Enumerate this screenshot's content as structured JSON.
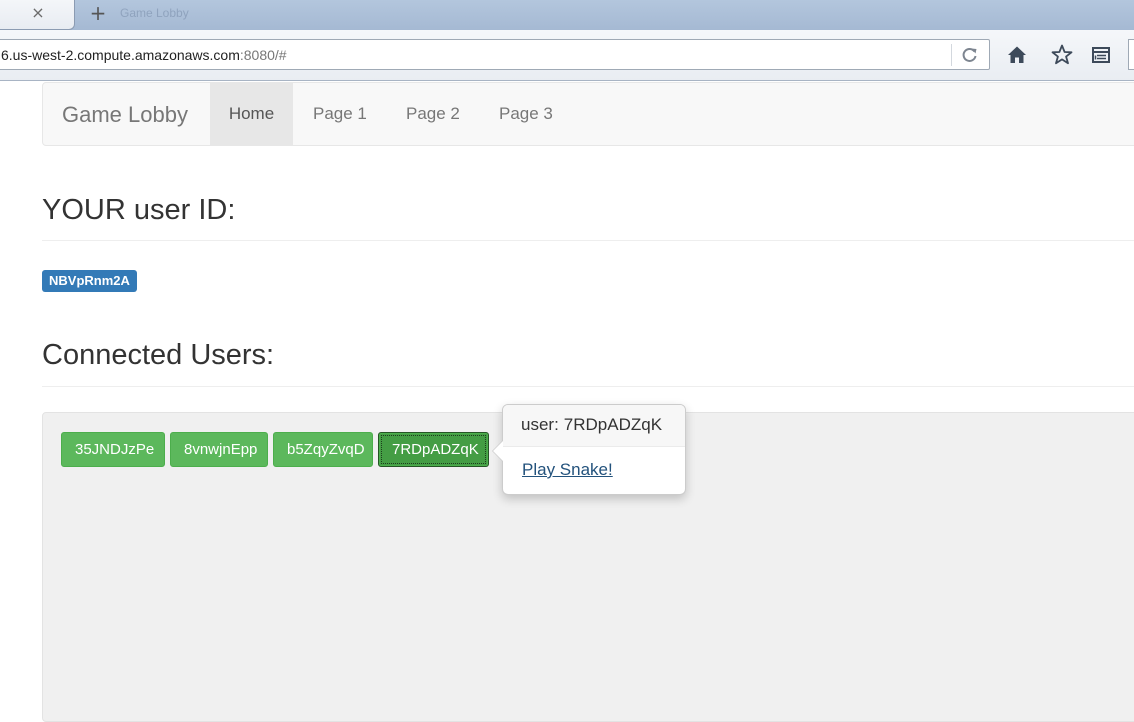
{
  "browser": {
    "tab_close_glyph": "×",
    "new_tab_glyph": "+",
    "ghost_tab_text": "Game Lobby",
    "url_host": "6.us-west-2.compute.amazonaws.com",
    "url_port": ":8080/#",
    "icons": [
      "close-icon",
      "plus-icon",
      "reload-icon",
      "home-icon",
      "star-icon",
      "menu-icon"
    ]
  },
  "navbar": {
    "brand": "Game Lobby",
    "items": [
      {
        "label": "Home",
        "active": true
      },
      {
        "label": "Page 1",
        "active": false
      },
      {
        "label": "Page 2",
        "active": false
      },
      {
        "label": "Page 3",
        "active": false
      }
    ]
  },
  "your_id": {
    "heading": "YOUR user ID:",
    "value": "NBVpRnm2A"
  },
  "connected": {
    "heading": "Connected Users:",
    "users": [
      "35JNDJzPe",
      "8vnwjnEpp",
      "b5ZqyZvqD",
      "7RDpADZqK"
    ]
  },
  "popover": {
    "title_prefix": "user:",
    "title_user": "7RDpADZqK",
    "link": "Play Snake!"
  },
  "colors": {
    "primary": "#337ab7",
    "success": "#5cb85c",
    "success_active": "#449d44",
    "link": "#23527c"
  }
}
